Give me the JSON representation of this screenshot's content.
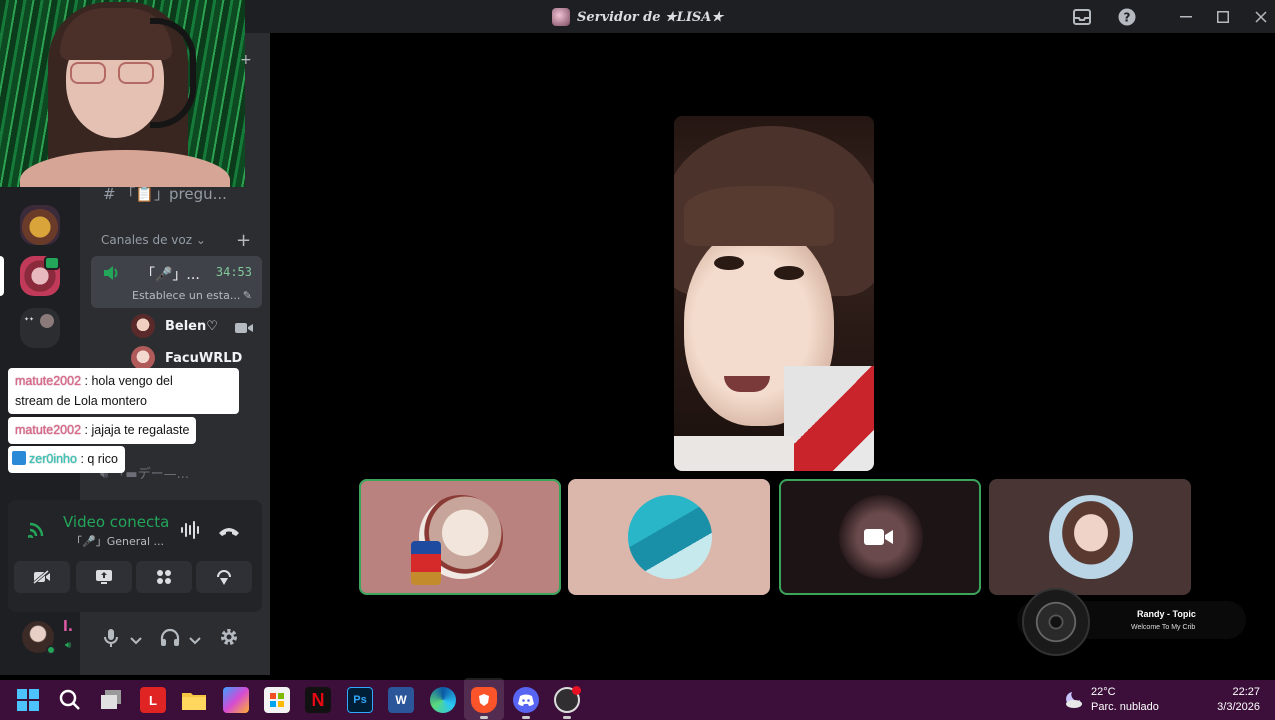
{
  "window": {
    "title": "Servidor de ★LISA★"
  },
  "sidebar": {
    "text_channel": "# 「📋」pregu...",
    "voice_category": "Canales de voz",
    "voice_channel": {
      "name": "「🎤」...",
      "timer": "34:53",
      "status": "Establece un esta..."
    },
    "members": [
      {
        "name": "Belen♡"
      },
      {
        "name": "FacuWRLD"
      }
    ],
    "hidden_channel": "「▬デー—..."
  },
  "chat_overlay": [
    {
      "user": "matute2002",
      "text": ": hola vengo del",
      "text2": "stream de Lola montero"
    },
    {
      "user": "matute2002",
      "text": ": jajaja te regalaste"
    },
    {
      "user": "zer0inho",
      "text": ": q rico"
    }
  ],
  "voice_panel": {
    "status": "Video conecta",
    "channel": "「🎤」General ..."
  },
  "user": {
    "name": "l."
  },
  "music_widget": {
    "artist": "Randy - Topic",
    "track": "Welcome To My Crib"
  },
  "taskbar": {
    "apps": [
      "start-icon",
      "search-icon",
      "task-view-icon",
      "l-app-icon",
      "file-explorer-icon",
      "copilot-icon",
      "store-icon",
      "netflix-icon",
      "photoshop-icon",
      "word-icon",
      "edge-icon",
      "brave-icon",
      "discord-icon",
      "obs-icon"
    ],
    "weather_temp": "22°C",
    "weather_desc": "Parc. nublado",
    "time": "22:27",
    "date": "3/3/2026"
  },
  "colors": {
    "accent_green": "#23a55a",
    "sidebar_bg": "#2b2d31",
    "rail_bg": "#1e1f22",
    "taskbar_bg": "#3b0f3a"
  }
}
